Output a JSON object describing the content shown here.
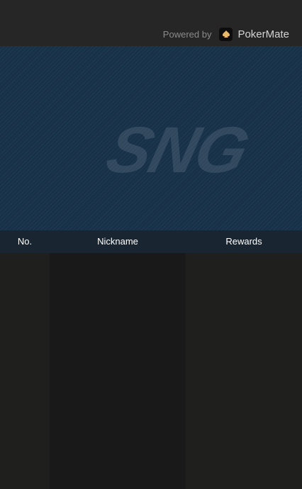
{
  "header": {
    "powered_by": "Powered by",
    "brand_name": "PokerMate",
    "logo_icon": "spade-icon"
  },
  "banner": {
    "watermark_text": "SNG",
    "background_color": "#173149"
  },
  "table": {
    "columns": [
      "No.",
      "Nickname",
      "Rewards"
    ],
    "rows": []
  }
}
